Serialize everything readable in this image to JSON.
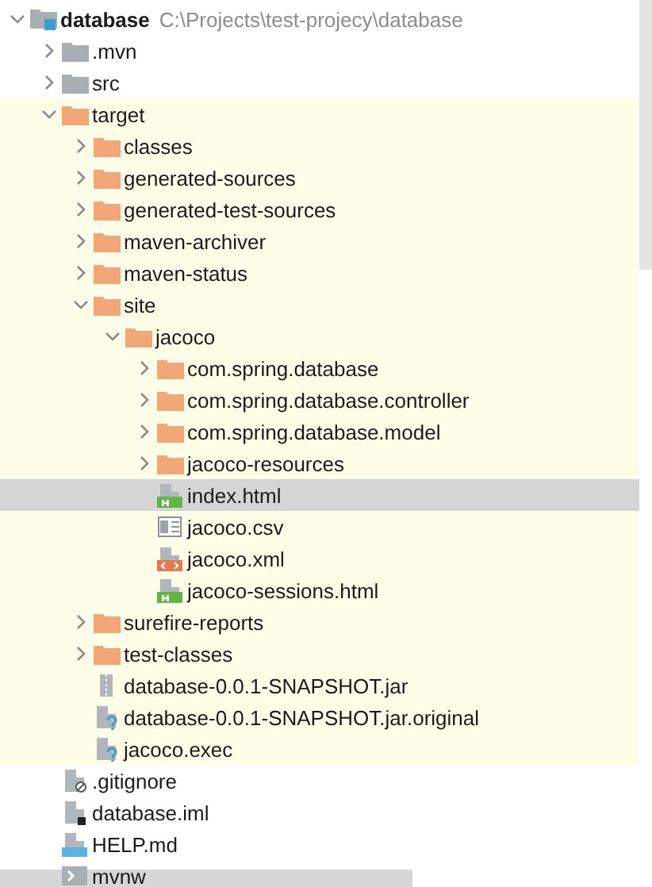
{
  "tree": [
    {
      "kind": "module",
      "label": "database",
      "path": "C:\\Projects\\test-projecy\\database",
      "expanded": true,
      "excluded": false,
      "selected": false,
      "children": [
        {
          "kind": "folder",
          "label": ".mvn",
          "expanded": false,
          "excluded": false,
          "selected": false
        },
        {
          "kind": "folder",
          "label": "src",
          "expanded": false,
          "excluded": false,
          "selected": false
        },
        {
          "kind": "folder",
          "label": "target",
          "expanded": true,
          "excluded": true,
          "selected": false,
          "children": [
            {
              "kind": "folder",
              "label": "classes",
              "expanded": false,
              "excluded": true,
              "selected": false
            },
            {
              "kind": "folder",
              "label": "generated-sources",
              "expanded": false,
              "excluded": true,
              "selected": false
            },
            {
              "kind": "folder",
              "label": "generated-test-sources",
              "expanded": false,
              "excluded": true,
              "selected": false
            },
            {
              "kind": "folder",
              "label": "maven-archiver",
              "expanded": false,
              "excluded": true,
              "selected": false
            },
            {
              "kind": "folder",
              "label": "maven-status",
              "expanded": false,
              "excluded": true,
              "selected": false
            },
            {
              "kind": "folder",
              "label": "site",
              "expanded": true,
              "excluded": true,
              "selected": false,
              "children": [
                {
                  "kind": "folder",
                  "label": "jacoco",
                  "expanded": true,
                  "excluded": true,
                  "selected": false,
                  "children": [
                    {
                      "kind": "folder",
                      "label": "com.spring.database",
                      "expanded": false,
                      "excluded": true,
                      "selected": false
                    },
                    {
                      "kind": "folder",
                      "label": "com.spring.database.controller",
                      "expanded": false,
                      "excluded": true,
                      "selected": false
                    },
                    {
                      "kind": "folder",
                      "label": "com.spring.database.model",
                      "expanded": false,
                      "excluded": true,
                      "selected": false
                    },
                    {
                      "kind": "folder",
                      "label": "jacoco-resources",
                      "expanded": false,
                      "excluded": true,
                      "selected": false
                    },
                    {
                      "kind": "html",
                      "label": "index.html",
                      "selected": true
                    },
                    {
                      "kind": "csv",
                      "label": "jacoco.csv",
                      "excluded": true,
                      "selected": false
                    },
                    {
                      "kind": "xml",
                      "label": "jacoco.xml",
                      "excluded": true,
                      "selected": false
                    },
                    {
                      "kind": "html",
                      "label": "jacoco-sessions.html",
                      "excluded": true,
                      "selected": false
                    }
                  ]
                }
              ]
            },
            {
              "kind": "folder",
              "label": "surefire-reports",
              "expanded": false,
              "excluded": true,
              "selected": false
            },
            {
              "kind": "folder",
              "label": "test-classes",
              "expanded": false,
              "excluded": true,
              "selected": false
            },
            {
              "kind": "jar",
              "label": "database-0.0.1-SNAPSHOT.jar",
              "excluded": true,
              "selected": false
            },
            {
              "kind": "unknown",
              "label": "database-0.0.1-SNAPSHOT.jar.original",
              "excluded": true,
              "selected": false
            },
            {
              "kind": "unknown",
              "label": "jacoco.exec",
              "excluded": true,
              "selected": false
            }
          ]
        },
        {
          "kind": "ignore",
          "label": ".gitignore",
          "excluded": false,
          "selected": false
        },
        {
          "kind": "iml",
          "label": "database.iml",
          "excluded": false,
          "selected": false
        },
        {
          "kind": "md",
          "label": "HELP.md",
          "excluded": false,
          "selected": false
        },
        {
          "kind": "shell",
          "label": "mvnw",
          "excluded": false,
          "selected": false
        }
      ]
    }
  ]
}
